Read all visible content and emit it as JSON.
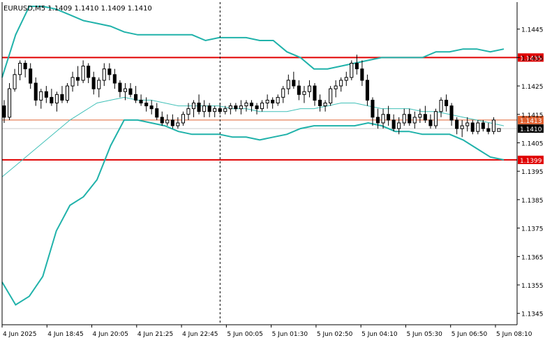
{
  "chart_title": "EURUSD,M5  1.1409 1.1410 1.1409 1.1410",
  "colors": {
    "background": "#ffffff",
    "axis": "#000000",
    "candle": "#000000",
    "band": "#20b2aa",
    "band_mid": "#40c0b8",
    "level": "#e00000",
    "level_thin": "#e06030",
    "current_price": "#cccccc"
  },
  "chart_data": {
    "type": "candlestick",
    "title": "EURUSD,M5  1.1409 1.1410 1.1409 1.1410",
    "ylim": [
      1.1341,
      1.14545
    ],
    "y_ticks": [
      "1.1445",
      "1.1435",
      "1.1425",
      "1.1415",
      "1.1405",
      "1.1395",
      "1.1385",
      "1.1375",
      "1.1365",
      "1.1355",
      "1.1345"
    ],
    "x_ticks": [
      "4 Jun 2025",
      "4 Jun 18:45",
      "4 Jun 20:05",
      "4 Jun 21:25",
      "4 Jun 22:45",
      "5 Jun 00:05",
      "5 Jun 01:30",
      "5 Jun 02:50",
      "5 Jun 04:10",
      "5 Jun 05:30",
      "5 Jun 06:50",
      "5 Jun 08:10"
    ],
    "separator_after_tick": "4 Jun 22:45",
    "horizontal_levels": [
      {
        "label": "1.1435",
        "value": 1.1435,
        "style": "thick"
      },
      {
        "label": "1.1413",
        "value": 1.1413,
        "style": "thin"
      },
      {
        "label": "1.1399",
        "value": 1.1399,
        "style": "thick"
      }
    ],
    "current_price": {
      "label": "1.1410",
      "value": 1.141
    },
    "bollinger": {
      "upper": [
        1.1428,
        1.1443,
        1.1453,
        1.1453,
        1.1452,
        1.145,
        1.1448,
        1.1447,
        1.1446,
        1.1444,
        1.1443,
        1.1443,
        1.1443,
        1.1443,
        1.1443,
        1.1441,
        1.1442,
        1.1442,
        1.1442,
        1.1441,
        1.1441,
        1.1437,
        1.1435,
        1.1431,
        1.1431,
        1.1432,
        1.1433,
        1.1434,
        1.1435,
        1.1435,
        1.1435,
        1.1435,
        1.1437,
        1.1437,
        1.1438,
        1.1438,
        1.1437,
        1.1438
      ],
      "middle": [
        1.1393,
        1.1397,
        1.1401,
        1.1405,
        1.1409,
        1.1413,
        1.1416,
        1.1419,
        1.142,
        1.1421,
        1.142,
        1.142,
        1.1419,
        1.1418,
        1.1418,
        1.1418,
        1.1418,
        1.1417,
        1.1417,
        1.1416,
        1.1416,
        1.1416,
        1.1417,
        1.1417,
        1.1418,
        1.1419,
        1.1419,
        1.1418,
        1.1417,
        1.1417,
        1.1417,
        1.1416,
        1.1416,
        1.1415,
        1.1414,
        1.1413,
        1.1412,
        1.1411
      ],
      "lower": [
        1.1356,
        1.1348,
        1.1351,
        1.1358,
        1.1374,
        1.1383,
        1.1386,
        1.1392,
        1.1404,
        1.1413,
        1.1413,
        1.1412,
        1.1411,
        1.1409,
        1.1408,
        1.1408,
        1.1408,
        1.1407,
        1.1407,
        1.1406,
        1.1407,
        1.1408,
        1.141,
        1.1411,
        1.1411,
        1.1411,
        1.1411,
        1.1412,
        1.1411,
        1.1409,
        1.1409,
        1.1408,
        1.1408,
        1.1408,
        1.1406,
        1.1403,
        1.14,
        1.1399
      ]
    },
    "candles": [
      [
        1.1418,
        1.142,
        1.1412,
        1.1414
      ],
      [
        1.1414,
        1.1426,
        1.1413,
        1.1424
      ],
      [
        1.1424,
        1.1431,
        1.1423,
        1.1429
      ],
      [
        1.1429,
        1.1434,
        1.1427,
        1.1433
      ],
      [
        1.1433,
        1.1434,
        1.1428,
        1.1431
      ],
      [
        1.1431,
        1.1433,
        1.1424,
        1.1426
      ],
      [
        1.1426,
        1.1428,
        1.1418,
        1.142
      ],
      [
        1.142,
        1.1424,
        1.1417,
        1.1423
      ],
      [
        1.1423,
        1.1425,
        1.1419,
        1.1421
      ],
      [
        1.1421,
        1.1424,
        1.1418,
        1.1419
      ],
      [
        1.1419,
        1.1423,
        1.1416,
        1.1422
      ],
      [
        1.1422,
        1.1425,
        1.1419,
        1.142
      ],
      [
        1.142,
        1.1426,
        1.1419,
        1.1425
      ],
      [
        1.1425,
        1.143,
        1.1423,
        1.1428
      ],
      [
        1.1428,
        1.1432,
        1.1425,
        1.1427
      ],
      [
        1.1427,
        1.1434,
        1.1426,
        1.1432
      ],
      [
        1.1432,
        1.1433,
        1.1426,
        1.1428
      ],
      [
        1.1428,
        1.143,
        1.1422,
        1.1424
      ],
      [
        1.1424,
        1.1428,
        1.1421,
        1.1427
      ],
      [
        1.1427,
        1.1433,
        1.1425,
        1.1431
      ],
      [
        1.1431,
        1.1433,
        1.1427,
        1.1429
      ],
      [
        1.1429,
        1.1431,
        1.1424,
        1.1426
      ],
      [
        1.1426,
        1.1427,
        1.1421,
        1.1423
      ],
      [
        1.1423,
        1.1426,
        1.142,
        1.1424
      ],
      [
        1.1424,
        1.1426,
        1.1421,
        1.1422
      ],
      [
        1.1422,
        1.1425,
        1.1419,
        1.142
      ],
      [
        1.142,
        1.1422,
        1.1418,
        1.1419
      ],
      [
        1.1419,
        1.1421,
        1.1416,
        1.1418
      ],
      [
        1.1418,
        1.142,
        1.1415,
        1.1417
      ],
      [
        1.1417,
        1.1419,
        1.1413,
        1.1414
      ],
      [
        1.1414,
        1.1416,
        1.1411,
        1.1412
      ],
      [
        1.1412,
        1.1415,
        1.1411,
        1.1413
      ],
      [
        1.1413,
        1.1415,
        1.141,
        1.1411
      ],
      [
        1.1411,
        1.1414,
        1.141,
        1.1412
      ],
      [
        1.1412,
        1.1416,
        1.1411,
        1.1415
      ],
      [
        1.1415,
        1.1419,
        1.1413,
        1.1417
      ],
      [
        1.1417,
        1.142,
        1.1414,
        1.1419
      ],
      [
        1.1419,
        1.1422,
        1.1415,
        1.1416
      ],
      [
        1.1416,
        1.142,
        1.1414,
        1.1418
      ],
      [
        1.1418,
        1.1419,
        1.1414,
        1.1416
      ],
      [
        1.1416,
        1.1418,
        1.1414,
        1.1417
      ],
      [
        1.1417,
        1.1419,
        1.1415,
        1.1416
      ],
      [
        1.1416,
        1.1418,
        1.1415,
        1.1417
      ],
      [
        1.1417,
        1.1419,
        1.1415,
        1.1418
      ],
      [
        1.1418,
        1.1419,
        1.1416,
        1.1417
      ],
      [
        1.1417,
        1.142,
        1.1415,
        1.1418
      ],
      [
        1.1418,
        1.142,
        1.1416,
        1.1419
      ],
      [
        1.1419,
        1.142,
        1.1416,
        1.1418
      ],
      [
        1.1418,
        1.1419,
        1.1415,
        1.1417
      ],
      [
        1.1417,
        1.142,
        1.1416,
        1.1419
      ],
      [
        1.1419,
        1.1422,
        1.1417,
        1.142
      ],
      [
        1.142,
        1.1421,
        1.1417,
        1.1419
      ],
      [
        1.1419,
        1.1422,
        1.1418,
        1.1421
      ],
      [
        1.1421,
        1.1425,
        1.1419,
        1.1424
      ],
      [
        1.1424,
        1.1429,
        1.1422,
        1.1427
      ],
      [
        1.1427,
        1.143,
        1.1424,
        1.1425
      ],
      [
        1.1425,
        1.1427,
        1.142,
        1.1422
      ],
      [
        1.1422,
        1.1425,
        1.1419,
        1.1423
      ],
      [
        1.1423,
        1.1427,
        1.1421,
        1.1425
      ],
      [
        1.1425,
        1.1426,
        1.1418,
        1.142
      ],
      [
        1.142,
        1.1422,
        1.1416,
        1.1418
      ],
      [
        1.1418,
        1.142,
        1.1416,
        1.1419
      ],
      [
        1.1419,
        1.1425,
        1.1418,
        1.1424
      ],
      [
        1.1424,
        1.1427,
        1.1421,
        1.1425
      ],
      [
        1.1425,
        1.1428,
        1.1423,
        1.1427
      ],
      [
        1.1427,
        1.143,
        1.1425,
        1.1428
      ],
      [
        1.1428,
        1.1434,
        1.1427,
        1.1433
      ],
      [
        1.1433,
        1.1436,
        1.1429,
        1.1431
      ],
      [
        1.1431,
        1.1434,
        1.1425,
        1.1427
      ],
      [
        1.1427,
        1.1429,
        1.1418,
        1.142
      ],
      [
        1.142,
        1.1421,
        1.1411,
        1.1414
      ],
      [
        1.1414,
        1.1417,
        1.141,
        1.1412
      ],
      [
        1.1412,
        1.1417,
        1.141,
        1.1415
      ],
      [
        1.1415,
        1.1418,
        1.1411,
        1.1413
      ],
      [
        1.1413,
        1.1415,
        1.1409,
        1.141
      ],
      [
        1.141,
        1.1414,
        1.1408,
        1.1412
      ],
      [
        1.1412,
        1.1417,
        1.1411,
        1.1415
      ],
      [
        1.1415,
        1.1417,
        1.1411,
        1.1412
      ],
      [
        1.1412,
        1.1416,
        1.141,
        1.1414
      ],
      [
        1.1414,
        1.1417,
        1.1412,
        1.1415
      ],
      [
        1.1415,
        1.1418,
        1.1412,
        1.1413
      ],
      [
        1.1413,
        1.1415,
        1.141,
        1.1411
      ],
      [
        1.1411,
        1.1417,
        1.141,
        1.1416
      ],
      [
        1.1416,
        1.1421,
        1.1414,
        1.142
      ],
      [
        1.142,
        1.1422,
        1.1416,
        1.1418
      ],
      [
        1.1418,
        1.1419,
        1.1411,
        1.1413
      ],
      [
        1.1413,
        1.1414,
        1.1408,
        1.141
      ],
      [
        1.141,
        1.1413,
        1.1407,
        1.1411
      ],
      [
        1.1411,
        1.1414,
        1.1409,
        1.1412
      ],
      [
        1.1412,
        1.1413,
        1.1408,
        1.1409
      ],
      [
        1.1409,
        1.1413,
        1.1408,
        1.1412
      ],
      [
        1.1412,
        1.1413,
        1.1409,
        1.141
      ],
      [
        1.141,
        1.1412,
        1.1408,
        1.1409
      ],
      [
        1.1409,
        1.1414,
        1.1408,
        1.1413
      ],
      [
        1.1409,
        1.141,
        1.1409,
        1.141
      ]
    ]
  }
}
